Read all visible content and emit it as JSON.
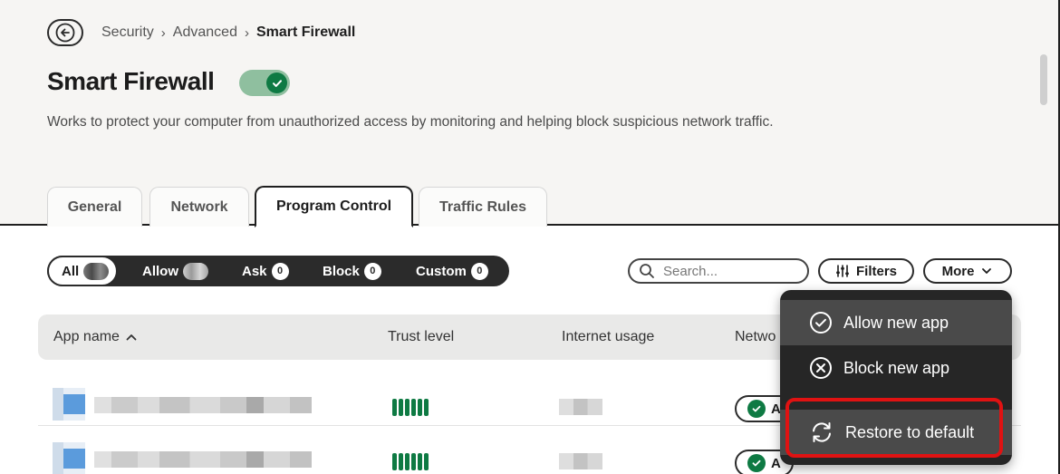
{
  "breadcrumb": {
    "items": [
      "Security",
      "Advanced",
      "Smart Firewall"
    ]
  },
  "page": {
    "title": "Smart Firewall",
    "toggle_on": true,
    "description": "Works to protect your computer from unauthorized access by monitoring and helping block suspicious network traffic."
  },
  "tabs": [
    "General",
    "Network",
    "Program Control",
    "Traffic Rules"
  ],
  "active_tab": "Program Control",
  "filters_segment": {
    "items": [
      {
        "label": "All",
        "count": ""
      },
      {
        "label": "Allow",
        "count": ""
      },
      {
        "label": "Ask",
        "count": "0"
      },
      {
        "label": "Block",
        "count": "0"
      },
      {
        "label": "Custom",
        "count": "0"
      }
    ],
    "active": "All"
  },
  "search": {
    "placeholder": "Search..."
  },
  "toolbar": {
    "filters_label": "Filters",
    "more_label": "More"
  },
  "table": {
    "columns": [
      "App name",
      "Trust level",
      "Internet usage",
      "Netwo"
    ],
    "sort_column": "App name",
    "sort_direction": "ascending",
    "rows": [
      {
        "status": "A",
        "trust_bars": 6
      },
      {
        "status": "A",
        "trust_bars": 6
      }
    ]
  },
  "more_menu": {
    "items": [
      {
        "label": "Allow new app",
        "icon": "check-circle-icon"
      },
      {
        "label": "Block new app",
        "icon": "x-circle-icon"
      },
      {
        "label": "Restore to default",
        "icon": "refresh-icon"
      }
    ],
    "highlighted": "Restore to default"
  },
  "colors": {
    "brand_green": "#0e7a43",
    "highlight_red": "#e01212",
    "menu_bg": "#262626"
  }
}
